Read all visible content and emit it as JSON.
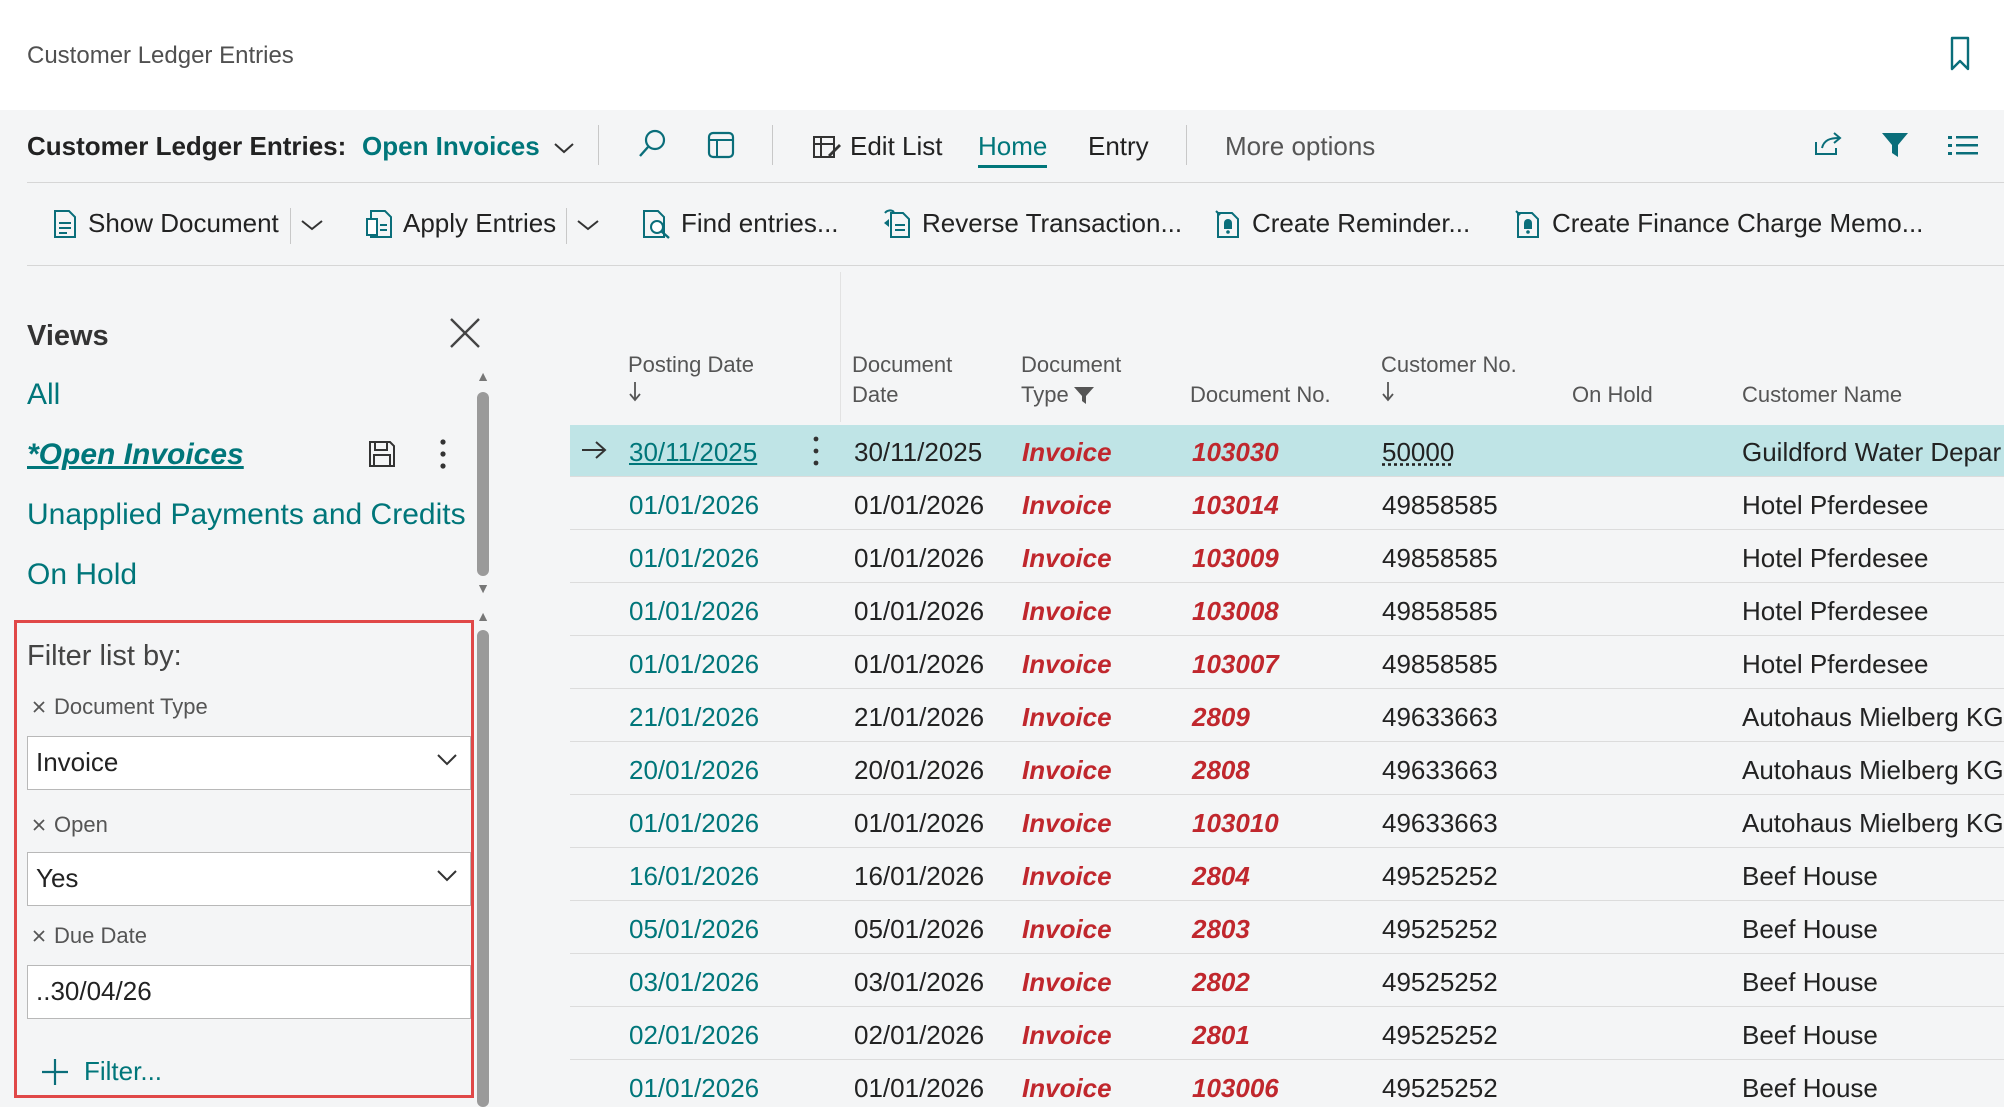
{
  "page": {
    "title": "Customer Ledger Entries"
  },
  "actionbar": {
    "label": "Customer Ledger Entries:",
    "view": "Open Invoices",
    "edit_list": "Edit List",
    "home": "Home",
    "entry": "Entry",
    "more": "More options"
  },
  "commands": {
    "show_document": "Show Document",
    "apply_entries": "Apply Entries",
    "find_entries": "Find entries...",
    "reverse": "Reverse Transaction...",
    "create_reminder": "Create Reminder...",
    "create_finance": "Create Finance Charge Memo..."
  },
  "views": {
    "title": "Views",
    "items": [
      "All",
      "*Open Invoices",
      "Unapplied Payments and Credits",
      "On Hold"
    ]
  },
  "filters": {
    "heading": "Filter list by:",
    "items": [
      {
        "label": "Document Type",
        "value": "Invoice"
      },
      {
        "label": "Open",
        "value": "Yes"
      },
      {
        "label": "Due Date",
        "value": "..30/04/26"
      }
    ],
    "add_label": "Filter..."
  },
  "table": {
    "columns": {
      "posting_date": "Posting Date",
      "document_date_1": "Document",
      "document_date_2": "Date",
      "document_type_1": "Document",
      "document_type_2": "Type",
      "document_no": "Document No.",
      "customer_no": "Customer No.",
      "on_hold": "On Hold",
      "customer_name": "Customer Name"
    },
    "rows": [
      {
        "posting_date": "30/11/2025",
        "document_date": "30/11/2025",
        "document_type": "Invoice",
        "document_no": "103030",
        "customer_no": "50000",
        "customer_name": "Guildford Water Depar"
      },
      {
        "posting_date": "01/01/2026",
        "document_date": "01/01/2026",
        "document_type": "Invoice",
        "document_no": "103014",
        "customer_no": "49858585",
        "customer_name": "Hotel Pferdesee"
      },
      {
        "posting_date": "01/01/2026",
        "document_date": "01/01/2026",
        "document_type": "Invoice",
        "document_no": "103009",
        "customer_no": "49858585",
        "customer_name": "Hotel Pferdesee"
      },
      {
        "posting_date": "01/01/2026",
        "document_date": "01/01/2026",
        "document_type": "Invoice",
        "document_no": "103008",
        "customer_no": "49858585",
        "customer_name": "Hotel Pferdesee"
      },
      {
        "posting_date": "01/01/2026",
        "document_date": "01/01/2026",
        "document_type": "Invoice",
        "document_no": "103007",
        "customer_no": "49858585",
        "customer_name": "Hotel Pferdesee"
      },
      {
        "posting_date": "21/01/2026",
        "document_date": "21/01/2026",
        "document_type": "Invoice",
        "document_no": "2809",
        "customer_no": "49633663",
        "customer_name": "Autohaus Mielberg KG"
      },
      {
        "posting_date": "20/01/2026",
        "document_date": "20/01/2026",
        "document_type": "Invoice",
        "document_no": "2808",
        "customer_no": "49633663",
        "customer_name": "Autohaus Mielberg KG"
      },
      {
        "posting_date": "01/01/2026",
        "document_date": "01/01/2026",
        "document_type": "Invoice",
        "document_no": "103010",
        "customer_no": "49633663",
        "customer_name": "Autohaus Mielberg KG"
      },
      {
        "posting_date": "16/01/2026",
        "document_date": "16/01/2026",
        "document_type": "Invoice",
        "document_no": "2804",
        "customer_no": "49525252",
        "customer_name": "Beef House"
      },
      {
        "posting_date": "05/01/2026",
        "document_date": "05/01/2026",
        "document_type": "Invoice",
        "document_no": "2803",
        "customer_no": "49525252",
        "customer_name": "Beef House"
      },
      {
        "posting_date": "03/01/2026",
        "document_date": "03/01/2026",
        "document_type": "Invoice",
        "document_no": "2802",
        "customer_no": "49525252",
        "customer_name": "Beef House"
      },
      {
        "posting_date": "02/01/2026",
        "document_date": "02/01/2026",
        "document_type": "Invoice",
        "document_no": "2801",
        "customer_no": "49525252",
        "customer_name": "Beef House"
      },
      {
        "posting_date": "01/01/2026",
        "document_date": "01/01/2026",
        "document_type": "Invoice",
        "document_no": "103006",
        "customer_no": "49525252",
        "customer_name": "Beef House"
      }
    ]
  },
  "colors": {
    "accent": "#00767a",
    "link_red": "#c0272d",
    "selected_row": "#bfe4e6",
    "highlight_border": "#e04848"
  }
}
